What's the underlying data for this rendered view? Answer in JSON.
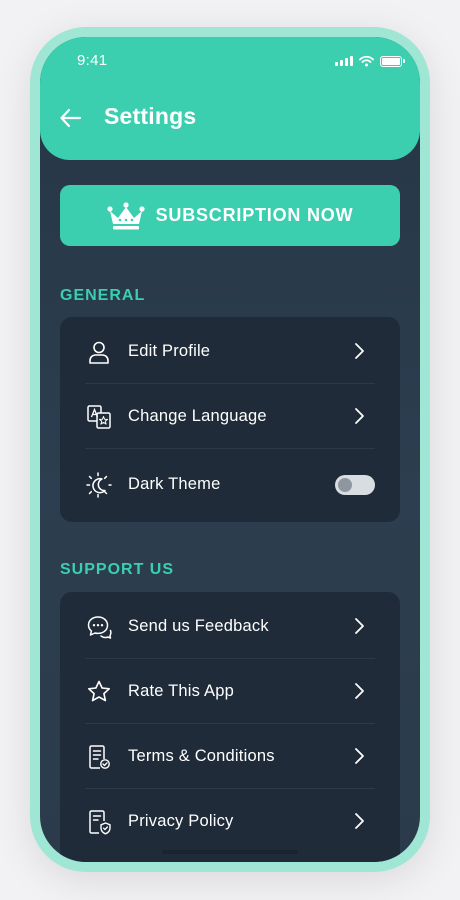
{
  "status_bar": {
    "time": "9:41",
    "icons": [
      "signal-icon",
      "wifi-icon",
      "battery-icon"
    ]
  },
  "header": {
    "title": "Settings",
    "back_icon": "arrow-left-icon"
  },
  "subscription": {
    "label": "SUBSCRIPTION NOW",
    "icon": "crown-icon"
  },
  "general": {
    "title": "GENERAL",
    "items": [
      {
        "label": "Edit Profile",
        "icon": "user-icon"
      },
      {
        "label": "Change Language",
        "icon": "translate-icon"
      },
      {
        "label": "Dark Theme",
        "icon": "moon-sun-icon",
        "toggle_on": false
      }
    ]
  },
  "support": {
    "title": "SUPPORT US",
    "items": [
      {
        "label": "Send us Feedback",
        "icon": "chat-bubble-icon"
      },
      {
        "label": "Rate This App",
        "icon": "star-icon"
      },
      {
        "label": "Terms & Conditions",
        "icon": "document-check-icon"
      },
      {
        "label": "Privacy Policy",
        "icon": "document-shield-icon"
      }
    ]
  },
  "colors": {
    "accent": "#3bcfb0",
    "frame": "#9fe6d4",
    "background": "#283848",
    "card": "#1f2b38",
    "text": "#ffffff"
  }
}
